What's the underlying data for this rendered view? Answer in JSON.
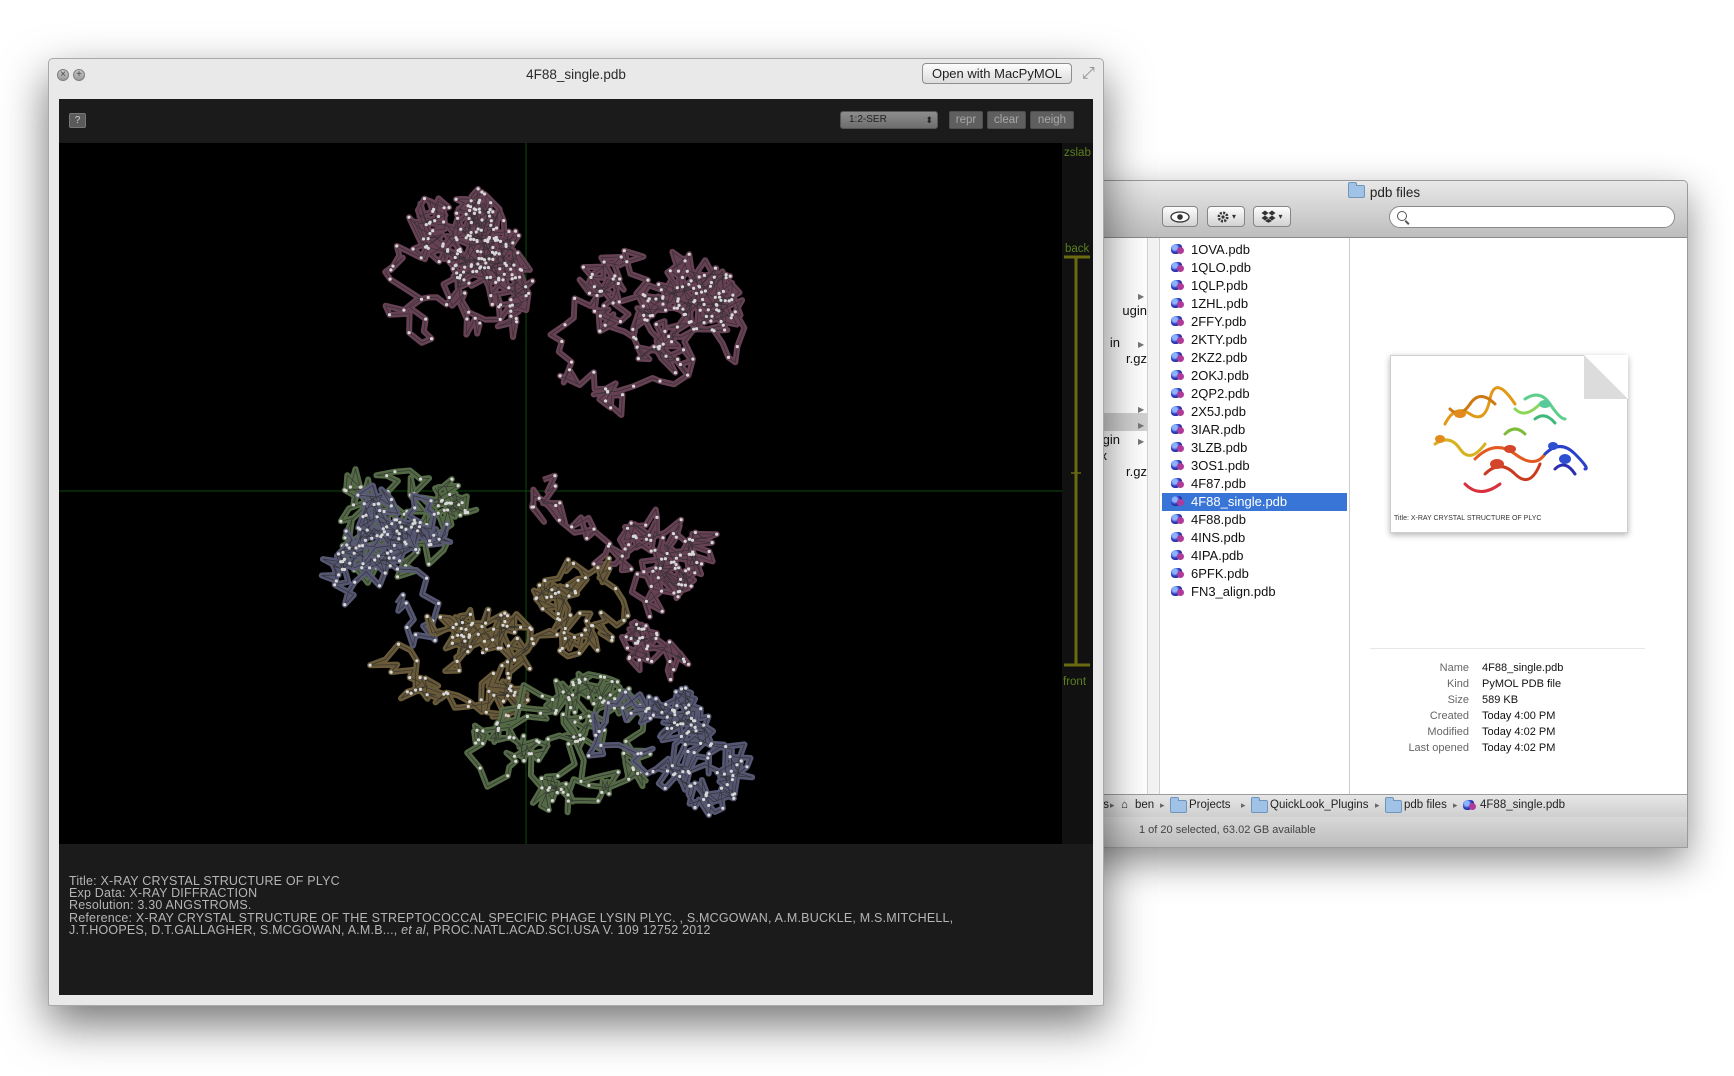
{
  "finder": {
    "title": "pdb files",
    "search_placeholder": "",
    "parent_items": [
      "ugin",
      "in",
      "r.gz",
      "gin",
      "x",
      "r.gz"
    ],
    "files": [
      "1OVA.pdb",
      "1QLO.pdb",
      "1QLP.pdb",
      "1ZHL.pdb",
      "2FFY.pdb",
      "2KTY.pdb",
      "2KZ2.pdb",
      "2OKJ.pdb",
      "2QP2.pdb",
      "2X5J.pdb",
      "3IAR.pdb",
      "3LZB.pdb",
      "3OS1.pdb",
      "4F87.pdb",
      "4F88_single.pdb",
      "4F88.pdb",
      "4INS.pdb",
      "4IPA.pdb",
      "6PFK.pdb",
      "FN3_align.pdb"
    ],
    "selected_index": 14,
    "preview_caption": "Title: X-RAY CRYSTAL STRUCTURE OF PLYC",
    "info": [
      {
        "label": "Name",
        "value": "4F88_single.pdb"
      },
      {
        "label": "Kind",
        "value": "PyMOL PDB file"
      },
      {
        "label": "Size",
        "value": "589 KB"
      },
      {
        "label": "Created",
        "value": "Today 4:00 PM"
      },
      {
        "label": "Modified",
        "value": "Today 4:02 PM"
      },
      {
        "label": "Last opened",
        "value": "Today 4:02 PM"
      }
    ],
    "path": [
      "Users",
      "ben",
      "Projects",
      "QuickLook_Plugins",
      "pdb files",
      "4F88_single.pdb"
    ],
    "status": "1 of 20 selected, 63.02 GB available"
  },
  "quicklook": {
    "title": "4F88_single.pdb",
    "open_button": "Open with MacPyMOL",
    "help_label": "?",
    "selector_value": "1:2-SER",
    "buttons": [
      "repr",
      "clear",
      "neigh"
    ],
    "z_labels": [
      "zslab",
      "back",
      "front"
    ],
    "metadata": {
      "title": "Title: X-RAY CRYSTAL STRUCTURE OF PLYC",
      "exp": "Exp Data: X-RAY DIFFRACTION",
      "resolution": "Resolution: 3.30 ANGSTROMS.",
      "reference_1": "Reference: X-RAY CRYSTAL STRUCTURE OF THE STREPTOCOCCAL SPECIFIC PHAGE LYSIN PLYC. , S.MCGOWAN, A.M.BUCKLE, M.S.MITCHELL,",
      "reference_2a": "J.T.HOOPES, D.T.GALLAGHER, S.MCGOWAN, A.M.B..., ",
      "reference_2b": "et al",
      "reference_2c": ", PROC.NATL.ACAD.SCI.USA V. 109 12752 2012"
    }
  },
  "colors": {
    "chain_mauve": "#6c4558",
    "chain_slate": "#5a5b78",
    "chain_green": "#596f4a",
    "chain_tan": "#6e5e3c",
    "selection_blue": "#3875d7",
    "zslab_green": "#5c7f1f"
  },
  "icons": [
    "folder-icon",
    "eye-icon",
    "gear-icon",
    "dropbox-icon",
    "search-icon",
    "home-icon",
    "pdb-file-icon",
    "close-icon",
    "plus-icon",
    "expand-icon"
  ]
}
